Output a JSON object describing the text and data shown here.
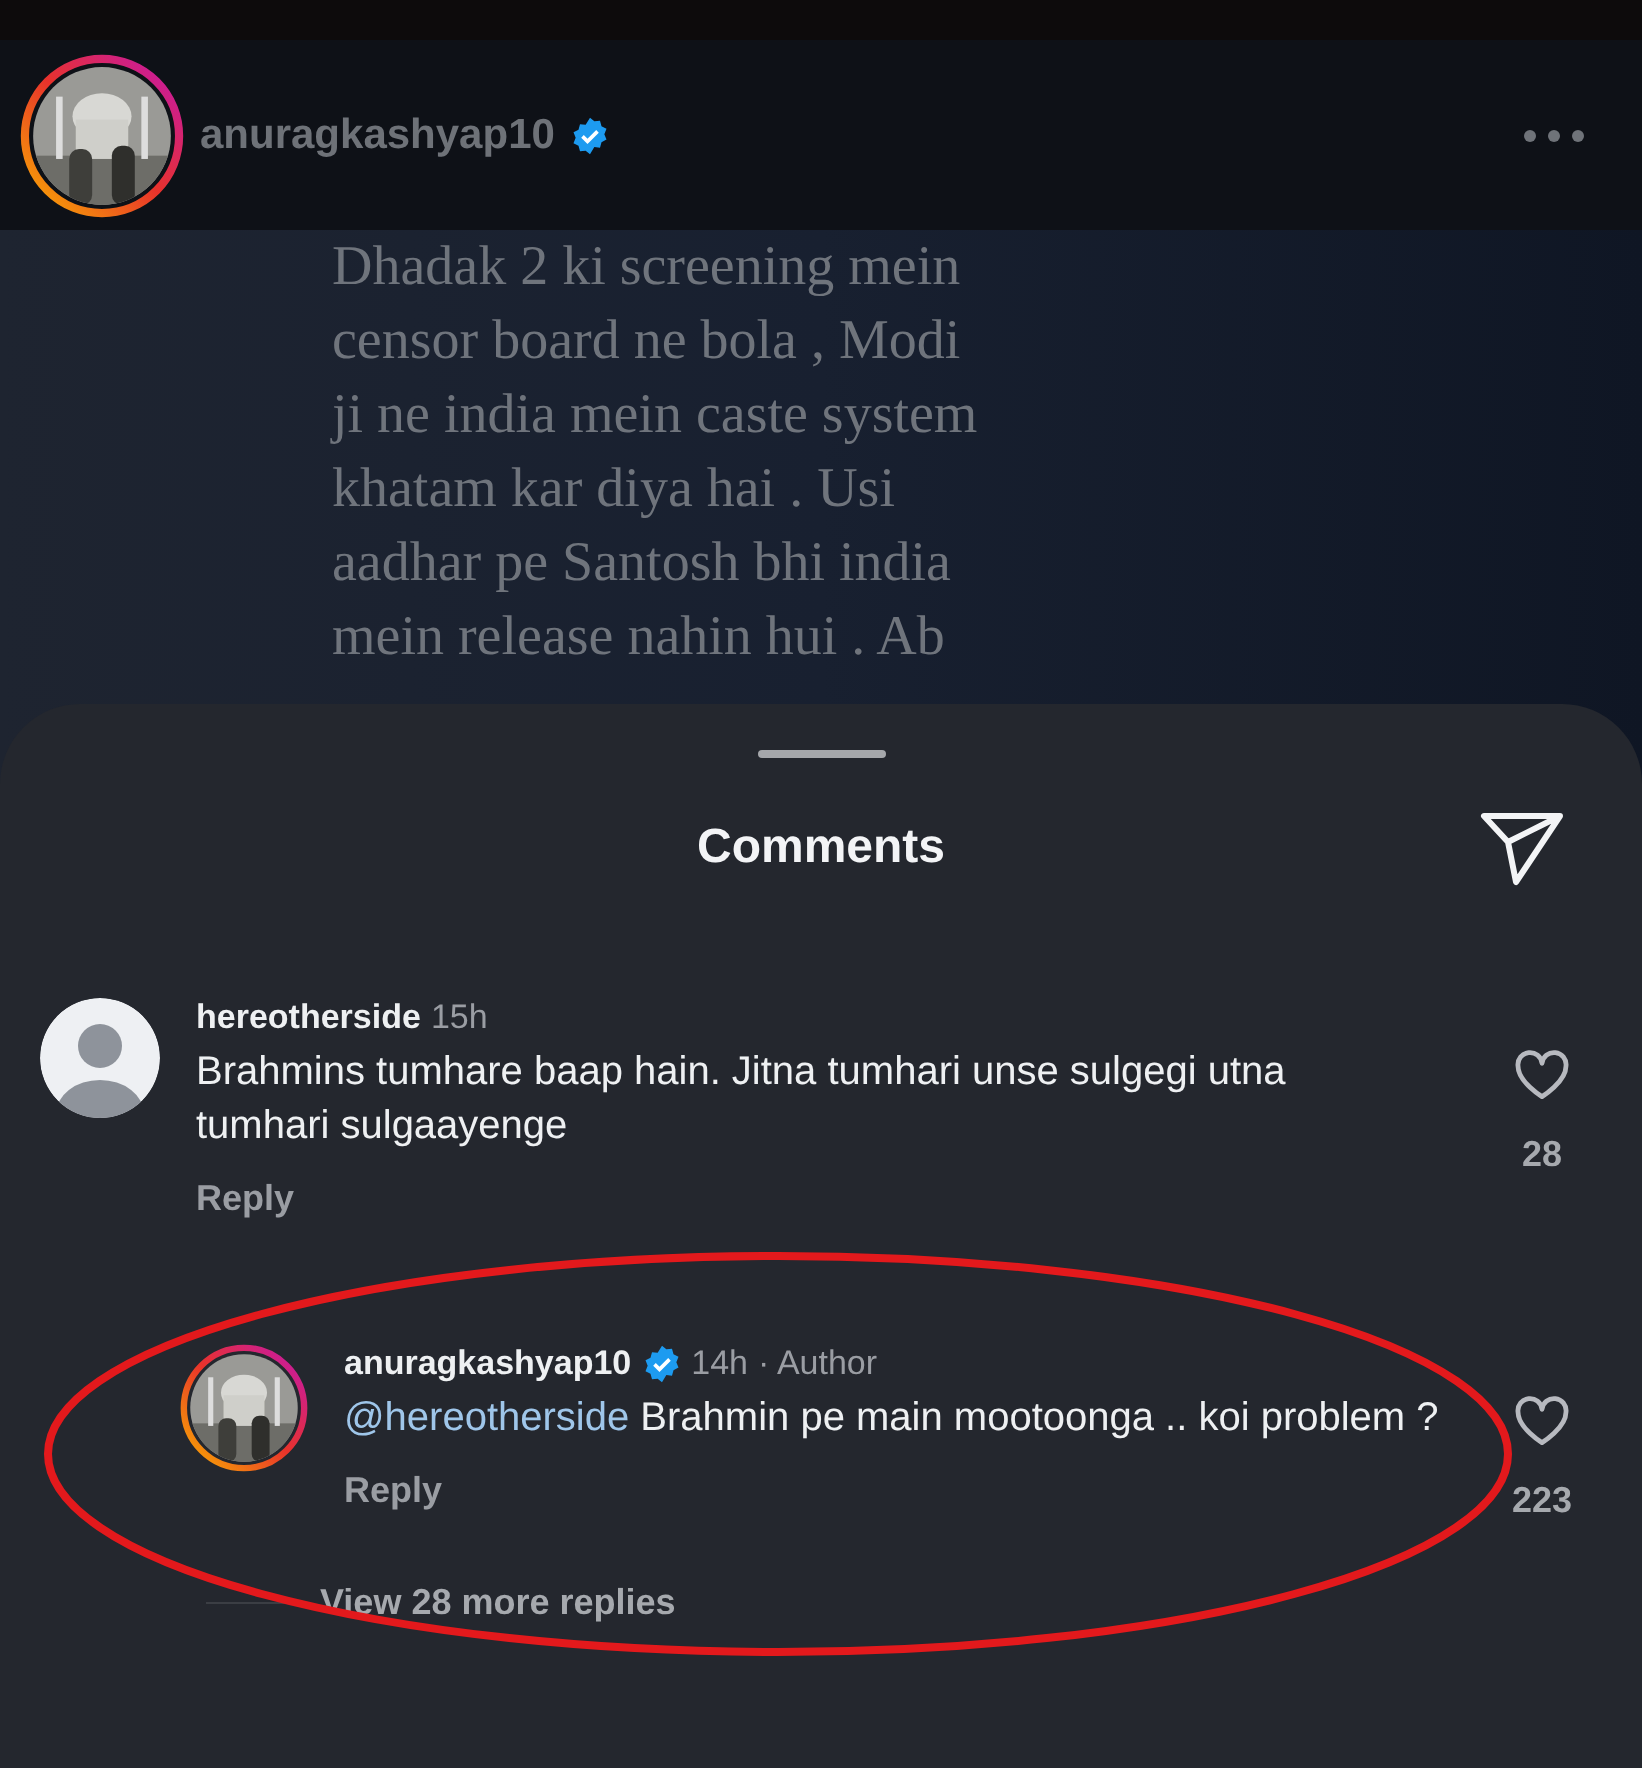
{
  "post": {
    "username": "anuragkashyap10",
    "verified": true,
    "image_lines": [
      "Dhadak 2 ki screening mein",
      "censor board ne bola , Modi",
      "ji ne india mein caste system",
      "khatam kar diya hai . Usi",
      "aadhar pe Santosh bhi india",
      "mein release nahin hui . Ab"
    ]
  },
  "sheet": {
    "title": "Comments"
  },
  "comments": [
    {
      "username": "hereotherside",
      "verified": false,
      "time": "15h",
      "text": "Brahmins tumhare baap hain. Jitna tumhari unse sulgegi utna tumhari sulgaayenge",
      "reply": "Reply",
      "likes": "28",
      "kind": "top",
      "story_ring": false
    },
    {
      "username": "anuragkashyap10",
      "verified": true,
      "time": "14h",
      "author": "· Author",
      "mention": "@hereotherside",
      "text": "Brahmin pe main mootoonga .. koi problem ?",
      "reply": "Reply",
      "likes": "223",
      "kind": "reply",
      "story_ring": true
    }
  ],
  "more_replies": "View 28 more replies"
}
